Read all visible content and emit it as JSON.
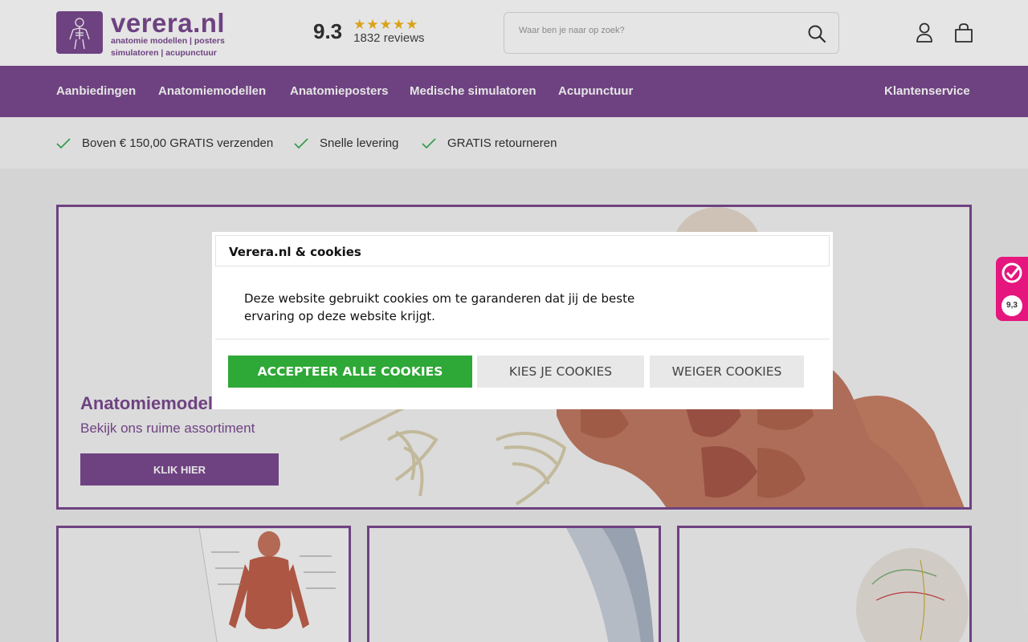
{
  "header": {
    "logo": {
      "name": "verera.nl",
      "tagline_1": "anatomie modellen | posters",
      "tagline_2": "simulatoren | acupunctuur"
    },
    "rating": {
      "score": "9.3",
      "stars": "★★★★★",
      "reviews": "1832 reviews"
    },
    "search": {
      "placeholder": "Waar ben je naar op zoek?"
    },
    "icons": [
      "search-icon",
      "account-icon",
      "shopping-bag-icon"
    ]
  },
  "nav": {
    "items": [
      "Aanbiedingen",
      "Anatomiemodellen",
      "Anatomieposters",
      "Medische simulatoren",
      "Acupunctuur"
    ],
    "customer_service": "Klantenservice"
  },
  "usp": [
    "Boven € 150,00 GRATIS verzenden",
    "Snelle levering",
    "GRATIS retourneren"
  ],
  "hero": {
    "title": "Anatomiemodellen",
    "subtitle": "Bekijk ons ruime assortiment",
    "button": "KLIK HIER"
  },
  "cookie_modal": {
    "title": "Verera.nl & cookies",
    "text": "Deze website gebruikt cookies om te garanderen dat jij de beste ervaring op deze website krijgt.",
    "accept": "ACCEPTEER ALLE COOKIES",
    "choose": "KIES JE COOKIES",
    "refuse": "WEIGER COOKIES"
  },
  "rating_widget": {
    "score": "9,3"
  },
  "colors": {
    "brand": "#7b4a90",
    "accept": "#2ea836",
    "star": "#f3b51b",
    "widget": "#e5167e",
    "check": "#3fae5a"
  }
}
